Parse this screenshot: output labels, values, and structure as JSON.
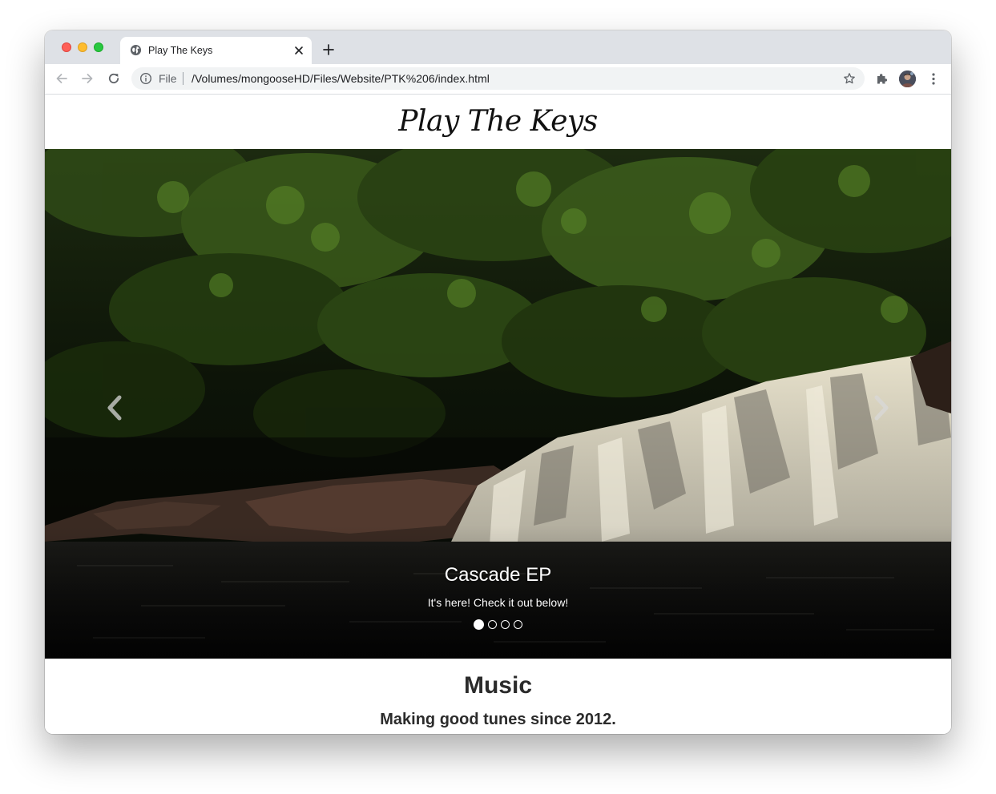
{
  "browser": {
    "tab": {
      "title": "Play The Keys"
    },
    "address_bar": {
      "scheme_label": "File",
      "url": "/Volumes/mongooseHD/Files/Website/PTK%206/index.html"
    },
    "icons": {
      "favicon": "globe-icon",
      "close": "close-icon",
      "new_tab": "plus-icon",
      "back": "arrow-left-icon",
      "forward": "arrow-right-icon",
      "reload": "reload-icon",
      "info": "info-icon",
      "bookmark": "star-icon",
      "extensions": "puzzle-icon",
      "profile": "avatar",
      "menu": "kebab-menu-icon"
    }
  },
  "site": {
    "brand": "Play The Keys",
    "carousel": {
      "caption_title": "Cascade EP",
      "caption_text": "It's here! Check it out below!",
      "slide_count": 4,
      "active_slide": 1,
      "prev_icon": "chevron-left-icon",
      "next_icon": "chevron-right-icon"
    },
    "section": {
      "title": "Music",
      "subtitle": "Making good tunes since 2012."
    }
  }
}
